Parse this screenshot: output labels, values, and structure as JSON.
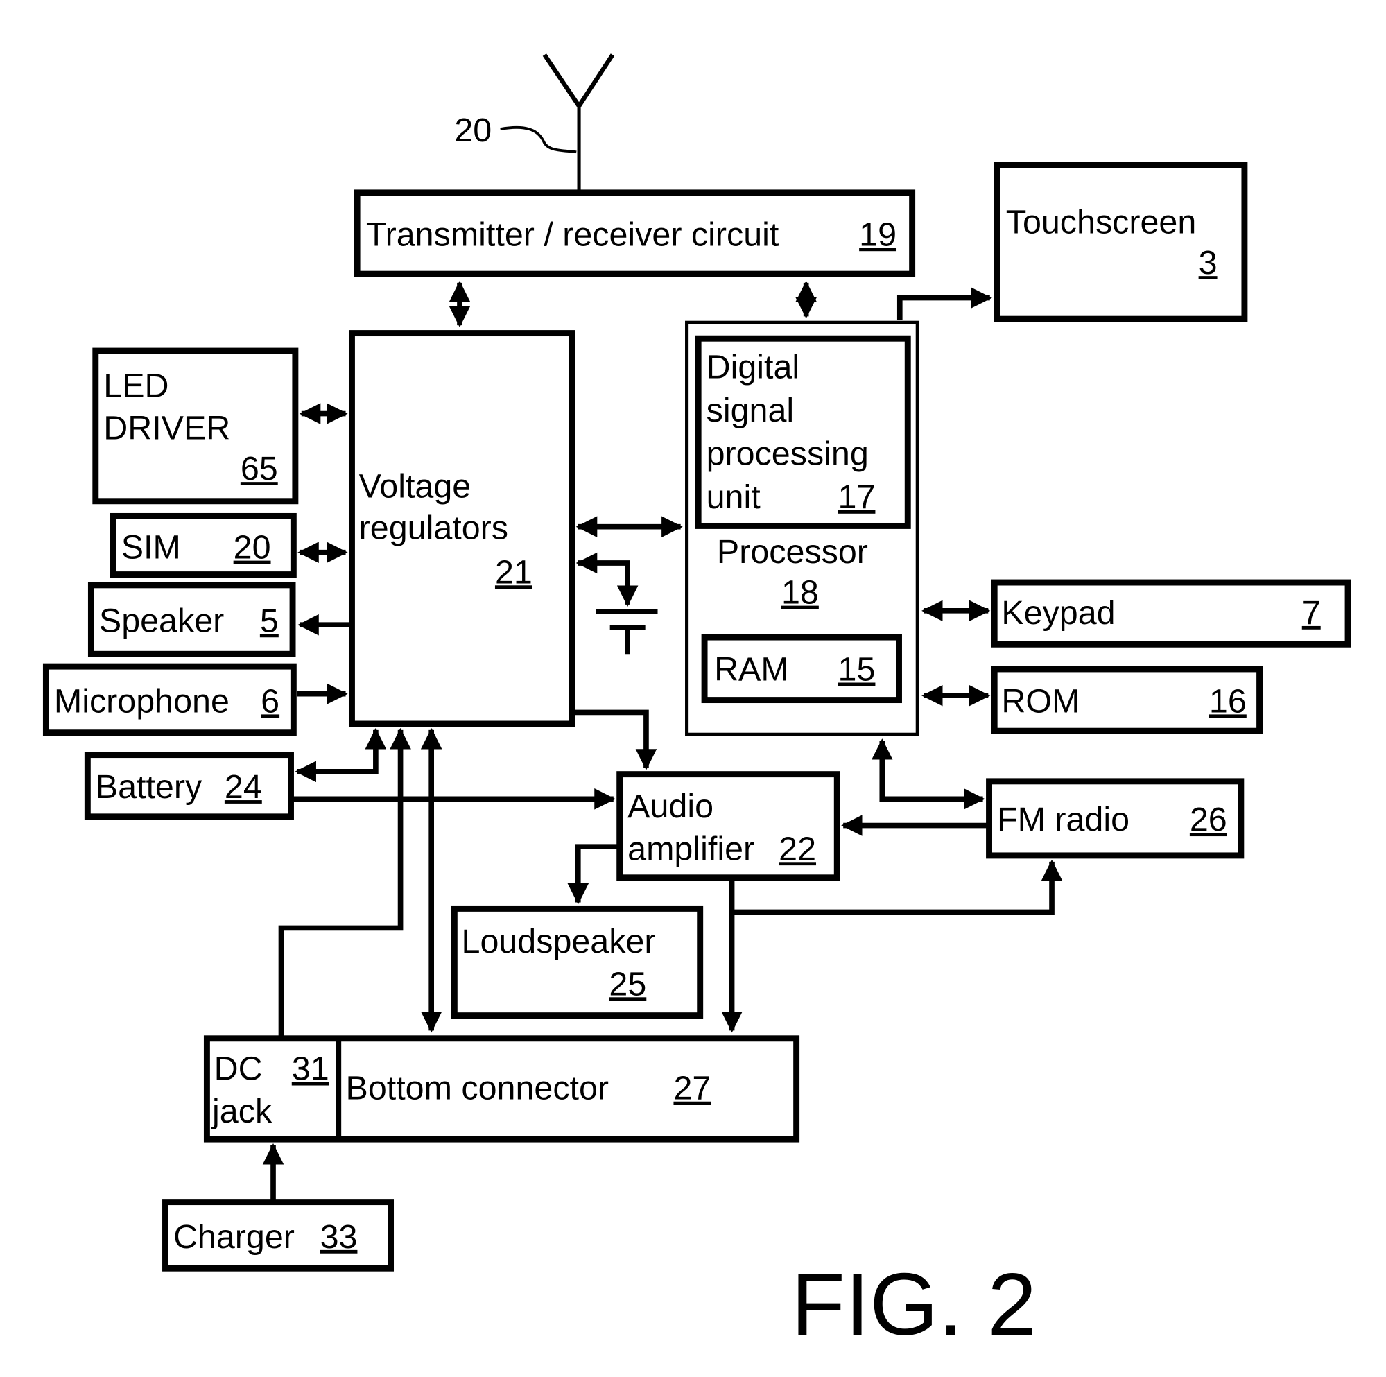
{
  "figure": {
    "caption": "FIG. 2"
  },
  "antenna": {
    "ref": "20"
  },
  "blocks": {
    "transceiver": {
      "label": "Transmitter / receiver circuit",
      "num": "19"
    },
    "touchscreen": {
      "label": "Touchscreen",
      "num": "3"
    },
    "led_driver": {
      "line1": "LED",
      "line2": "DRIVER",
      "num": "65"
    },
    "sim": {
      "label": "SIM",
      "num": "20"
    },
    "speaker": {
      "label": "Speaker",
      "num": "5"
    },
    "microphone": {
      "label": "Microphone",
      "num": "6"
    },
    "battery": {
      "label": "Battery",
      "num": "24"
    },
    "voltage_regulators": {
      "line1": "Voltage",
      "line2": "regulators",
      "num": "21"
    },
    "dsp": {
      "line1": "Digital",
      "line2": "signal",
      "line3": "processing",
      "line4": "unit",
      "num": "17"
    },
    "processor": {
      "label": "Processor",
      "num": "18"
    },
    "ram": {
      "label": "RAM",
      "num": "15"
    },
    "keypad": {
      "label": "Keypad",
      "num": "7"
    },
    "rom": {
      "label": "ROM",
      "num": "16"
    },
    "audio_amplifier": {
      "line1": "Audio",
      "line2": "amplifier",
      "num": "22"
    },
    "fm_radio": {
      "label": "FM radio",
      "num": "26"
    },
    "loudspeaker": {
      "label": "Loudspeaker",
      "num": "25"
    },
    "dc_jack": {
      "line1": "DC",
      "line2": "jack",
      "num": "31"
    },
    "bottom_connector": {
      "label": "Bottom connector",
      "num": "27"
    },
    "charger": {
      "label": "Charger",
      "num": "33"
    }
  }
}
